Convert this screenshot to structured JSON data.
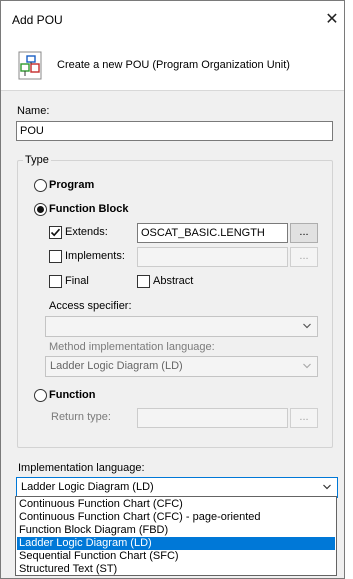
{
  "window": {
    "title": "Add POU",
    "close_glyph": "✕"
  },
  "header": {
    "description": "Create a new POU (Program Organization Unit)",
    "icon": "pou-icon"
  },
  "name_field": {
    "label": "Name:",
    "value": "POU"
  },
  "type_group": {
    "legend": "Type",
    "program_label": "Program",
    "function_block_label": "Function Block",
    "extends": {
      "label": "Extends:",
      "checked": true,
      "value": "OSCAT_BASIC.LENGTH",
      "browse_label": "..."
    },
    "implements": {
      "label": "Implements:",
      "checked": false,
      "value": "",
      "browse_label": "..."
    },
    "final_label": "Final",
    "abstract_label": "Abstract",
    "access_specifier": {
      "label": "Access specifier:",
      "value": ""
    },
    "method_impl_language": {
      "label": "Method implementation language:",
      "value": "Ladder Logic Diagram (LD)"
    },
    "function_label": "Function",
    "return_type": {
      "label": "Return type:",
      "value": "",
      "browse_label": "..."
    },
    "selected": "Function Block"
  },
  "implementation_language": {
    "label": "Implementation language:",
    "value": "Ladder Logic Diagram (LD)",
    "options": [
      "Continuous Function Chart (CFC)",
      "Continuous Function Chart (CFC) - page-oriented",
      "Function Block Diagram (FBD)",
      "Ladder Logic Diagram (LD)",
      "Sequential Function Chart (SFC)",
      "Structured Text (ST)"
    ],
    "selected_index": 3
  },
  "colors": {
    "selection": "#0078d7",
    "dialog_bg": "#f0f0f0"
  }
}
